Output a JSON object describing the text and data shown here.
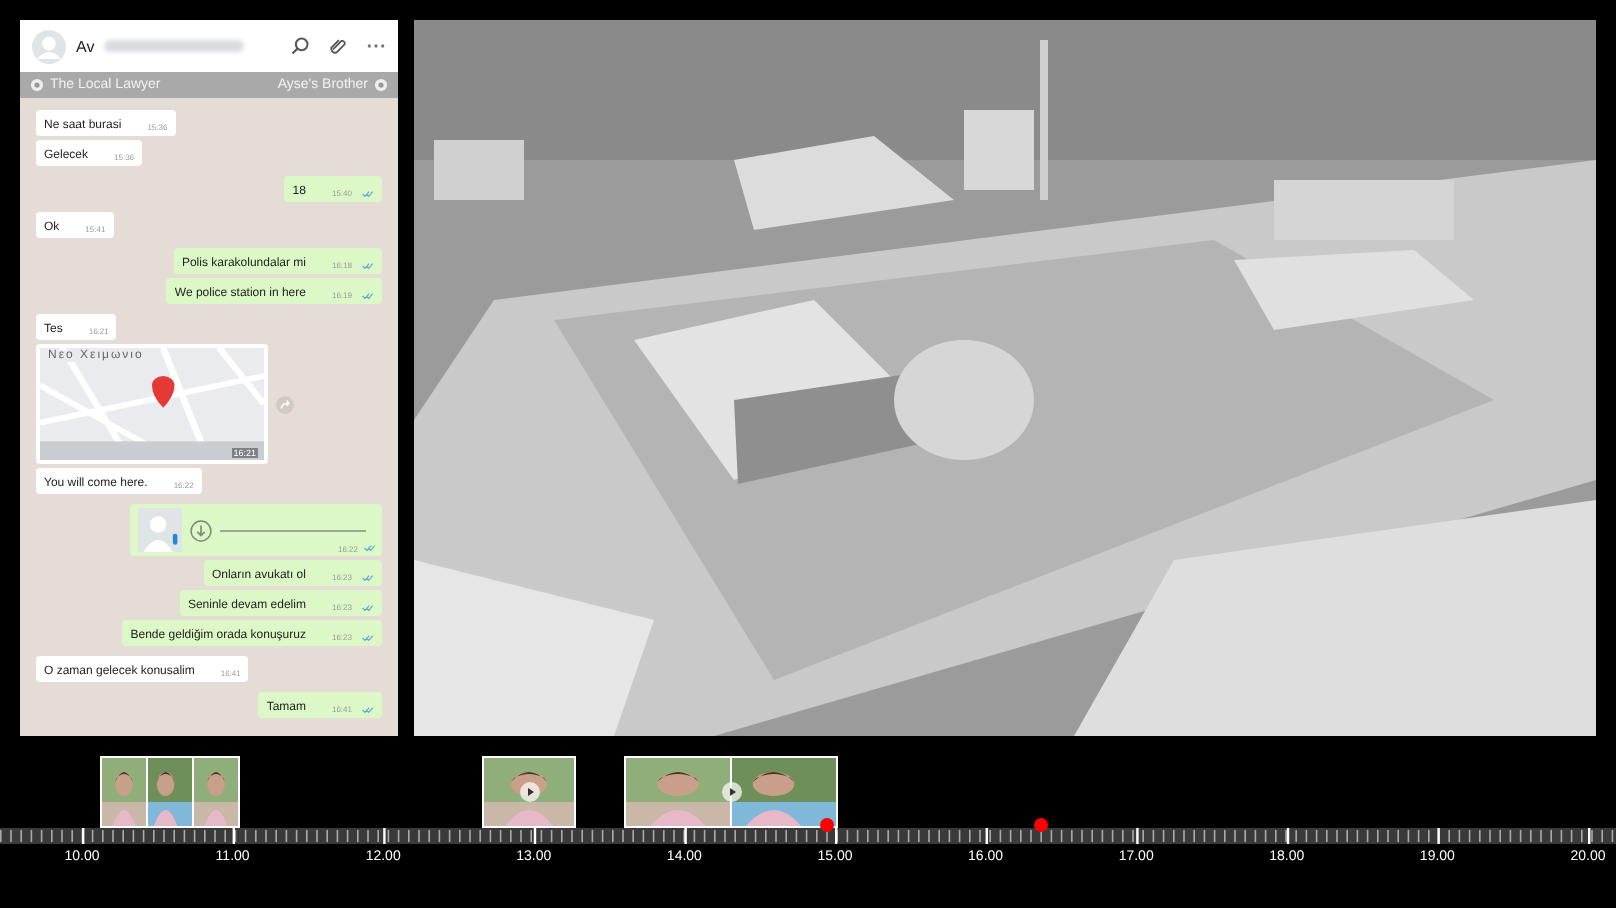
{
  "chat": {
    "contact": {
      "name": "Av"
    },
    "participants": {
      "left": "The Local Lawyer",
      "right": "Ayse's Brother"
    },
    "messages": [
      {
        "kind": "text",
        "outgoing": false,
        "text": "Ne saat burasi",
        "time": "15:36"
      },
      {
        "kind": "text",
        "outgoing": false,
        "text": "Gelecek",
        "time": "15:36"
      },
      {
        "kind": "text",
        "outgoing": true,
        "text": "18",
        "time": "15:40"
      },
      {
        "kind": "text",
        "outgoing": false,
        "text": "Ok",
        "time": "15:41"
      },
      {
        "kind": "text",
        "outgoing": true,
        "text": "Polis karakolundalar mi",
        "time": "16:18"
      },
      {
        "kind": "text",
        "outgoing": true,
        "text": "We police station in here",
        "time": "16:19"
      },
      {
        "kind": "text",
        "outgoing": false,
        "text": "Tes",
        "time": "16:21"
      },
      {
        "kind": "map",
        "outgoing": false,
        "text": "Νεο Χειμωνιο",
        "time": "16:21"
      },
      {
        "kind": "text",
        "outgoing": false,
        "text": "You will come here.",
        "time": "16:22"
      },
      {
        "kind": "voice",
        "outgoing": true,
        "time": "16:22"
      },
      {
        "kind": "text",
        "outgoing": true,
        "text": "Onların avukatı ol",
        "time": "16:23"
      },
      {
        "kind": "text",
        "outgoing": true,
        "text": "Seninle devam edelim",
        "time": "16:23"
      },
      {
        "kind": "text",
        "outgoing": true,
        "text": "Bende geldiğim orada konuşuruz",
        "time": "16:23"
      },
      {
        "kind": "text",
        "outgoing": false,
        "text": "O zaman gelecek konusalim",
        "time": "16:41"
      },
      {
        "kind": "text",
        "outgoing": true,
        "text": "Tamam",
        "time": "16:41"
      }
    ]
  },
  "timeline": {
    "labels": [
      "10.00",
      "11.00",
      "12.00",
      "13.00",
      "14.00",
      "15.00",
      "16.00",
      "17.00",
      "18.00",
      "19.00",
      "20.00"
    ],
    "clips": [
      {
        "play": false
      },
      {
        "play": true
      },
      {
        "play": true
      }
    ],
    "markers": [
      {
        "color": "#ff0000"
      },
      {
        "color": "#ff0000"
      }
    ]
  }
}
